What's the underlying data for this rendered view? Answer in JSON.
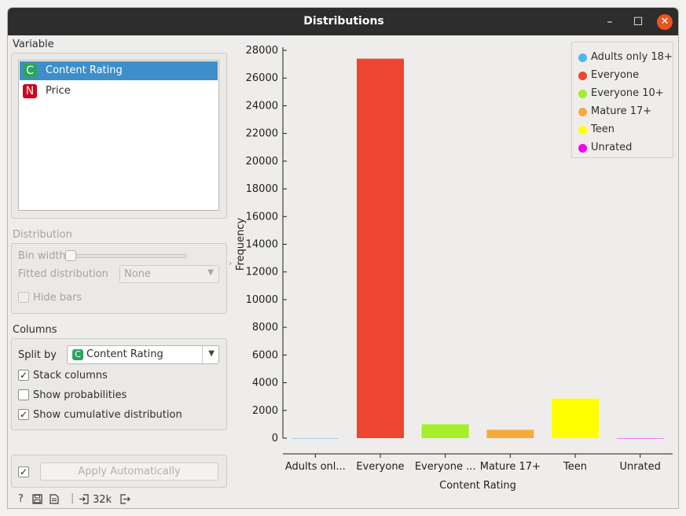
{
  "window": {
    "title": "Distributions",
    "controls": {
      "minimize": "–",
      "maximize": "☐",
      "close": "✕"
    }
  },
  "variable": {
    "label": "Variable",
    "items": [
      {
        "type": "C",
        "name": "Content Rating",
        "selected": true
      },
      {
        "type": "N",
        "name": "Price",
        "selected": false
      }
    ]
  },
  "distribution": {
    "label": "Distribution",
    "bin_width_label": "Bin width",
    "bin_width_level": 0.0,
    "fitted_label": "Fitted distribution",
    "fitted_value": "None",
    "hide_bars_label": "Hide bars",
    "hide_bars_checked": false
  },
  "columns": {
    "label": "Columns",
    "split_by_label": "Split by",
    "split_by_type": "C",
    "split_by_value": "Content Rating",
    "stack_columns_label": "Stack columns",
    "stack_columns_checked": true,
    "show_probabilities_label": "Show probabilities",
    "show_probabilities_checked": false,
    "show_cumulative_label": "Show cumulative distribution",
    "show_cumulative_checked": true
  },
  "apply": {
    "checked": true,
    "label": "Apply Automatically"
  },
  "status": {
    "help_icon": "?",
    "save_icon": "save-icon",
    "report_icon": "report-icon",
    "input_count": "32k"
  },
  "colors": {
    "Adults only 18+": "#4db6ec",
    "Everyone": "#ee4630",
    "Everyone 10+": "#a6ee2a",
    "Mature 17+": "#f6aa3a",
    "Teen": "#ffff00",
    "Unrated": "#f500f5"
  },
  "legend": [
    "Adults only 18+",
    "Everyone",
    "Everyone 10+",
    "Mature 17+",
    "Teen",
    "Unrated"
  ],
  "chart_data": {
    "type": "bar",
    "categories": [
      "Adults only 18+",
      "Everyone",
      "Everyone 10+",
      "Mature 17+",
      "Teen",
      "Unrated"
    ],
    "tick_labels": [
      "Adults onl...",
      "Everyone",
      "Everyone ...",
      "Mature 17+",
      "Teen",
      "Unrated"
    ],
    "values": [
      3,
      27400,
      1000,
      600,
      2850,
      2
    ],
    "xlabel": "Content Rating",
    "ylabel": "Frequency",
    "ylim": [
      0,
      28000
    ],
    "yticks": [
      0,
      2000,
      4000,
      6000,
      8000,
      10000,
      12000,
      14000,
      16000,
      18000,
      20000,
      22000,
      24000,
      26000,
      28000
    ],
    "legend_position": "top-right",
    "grid": false
  }
}
